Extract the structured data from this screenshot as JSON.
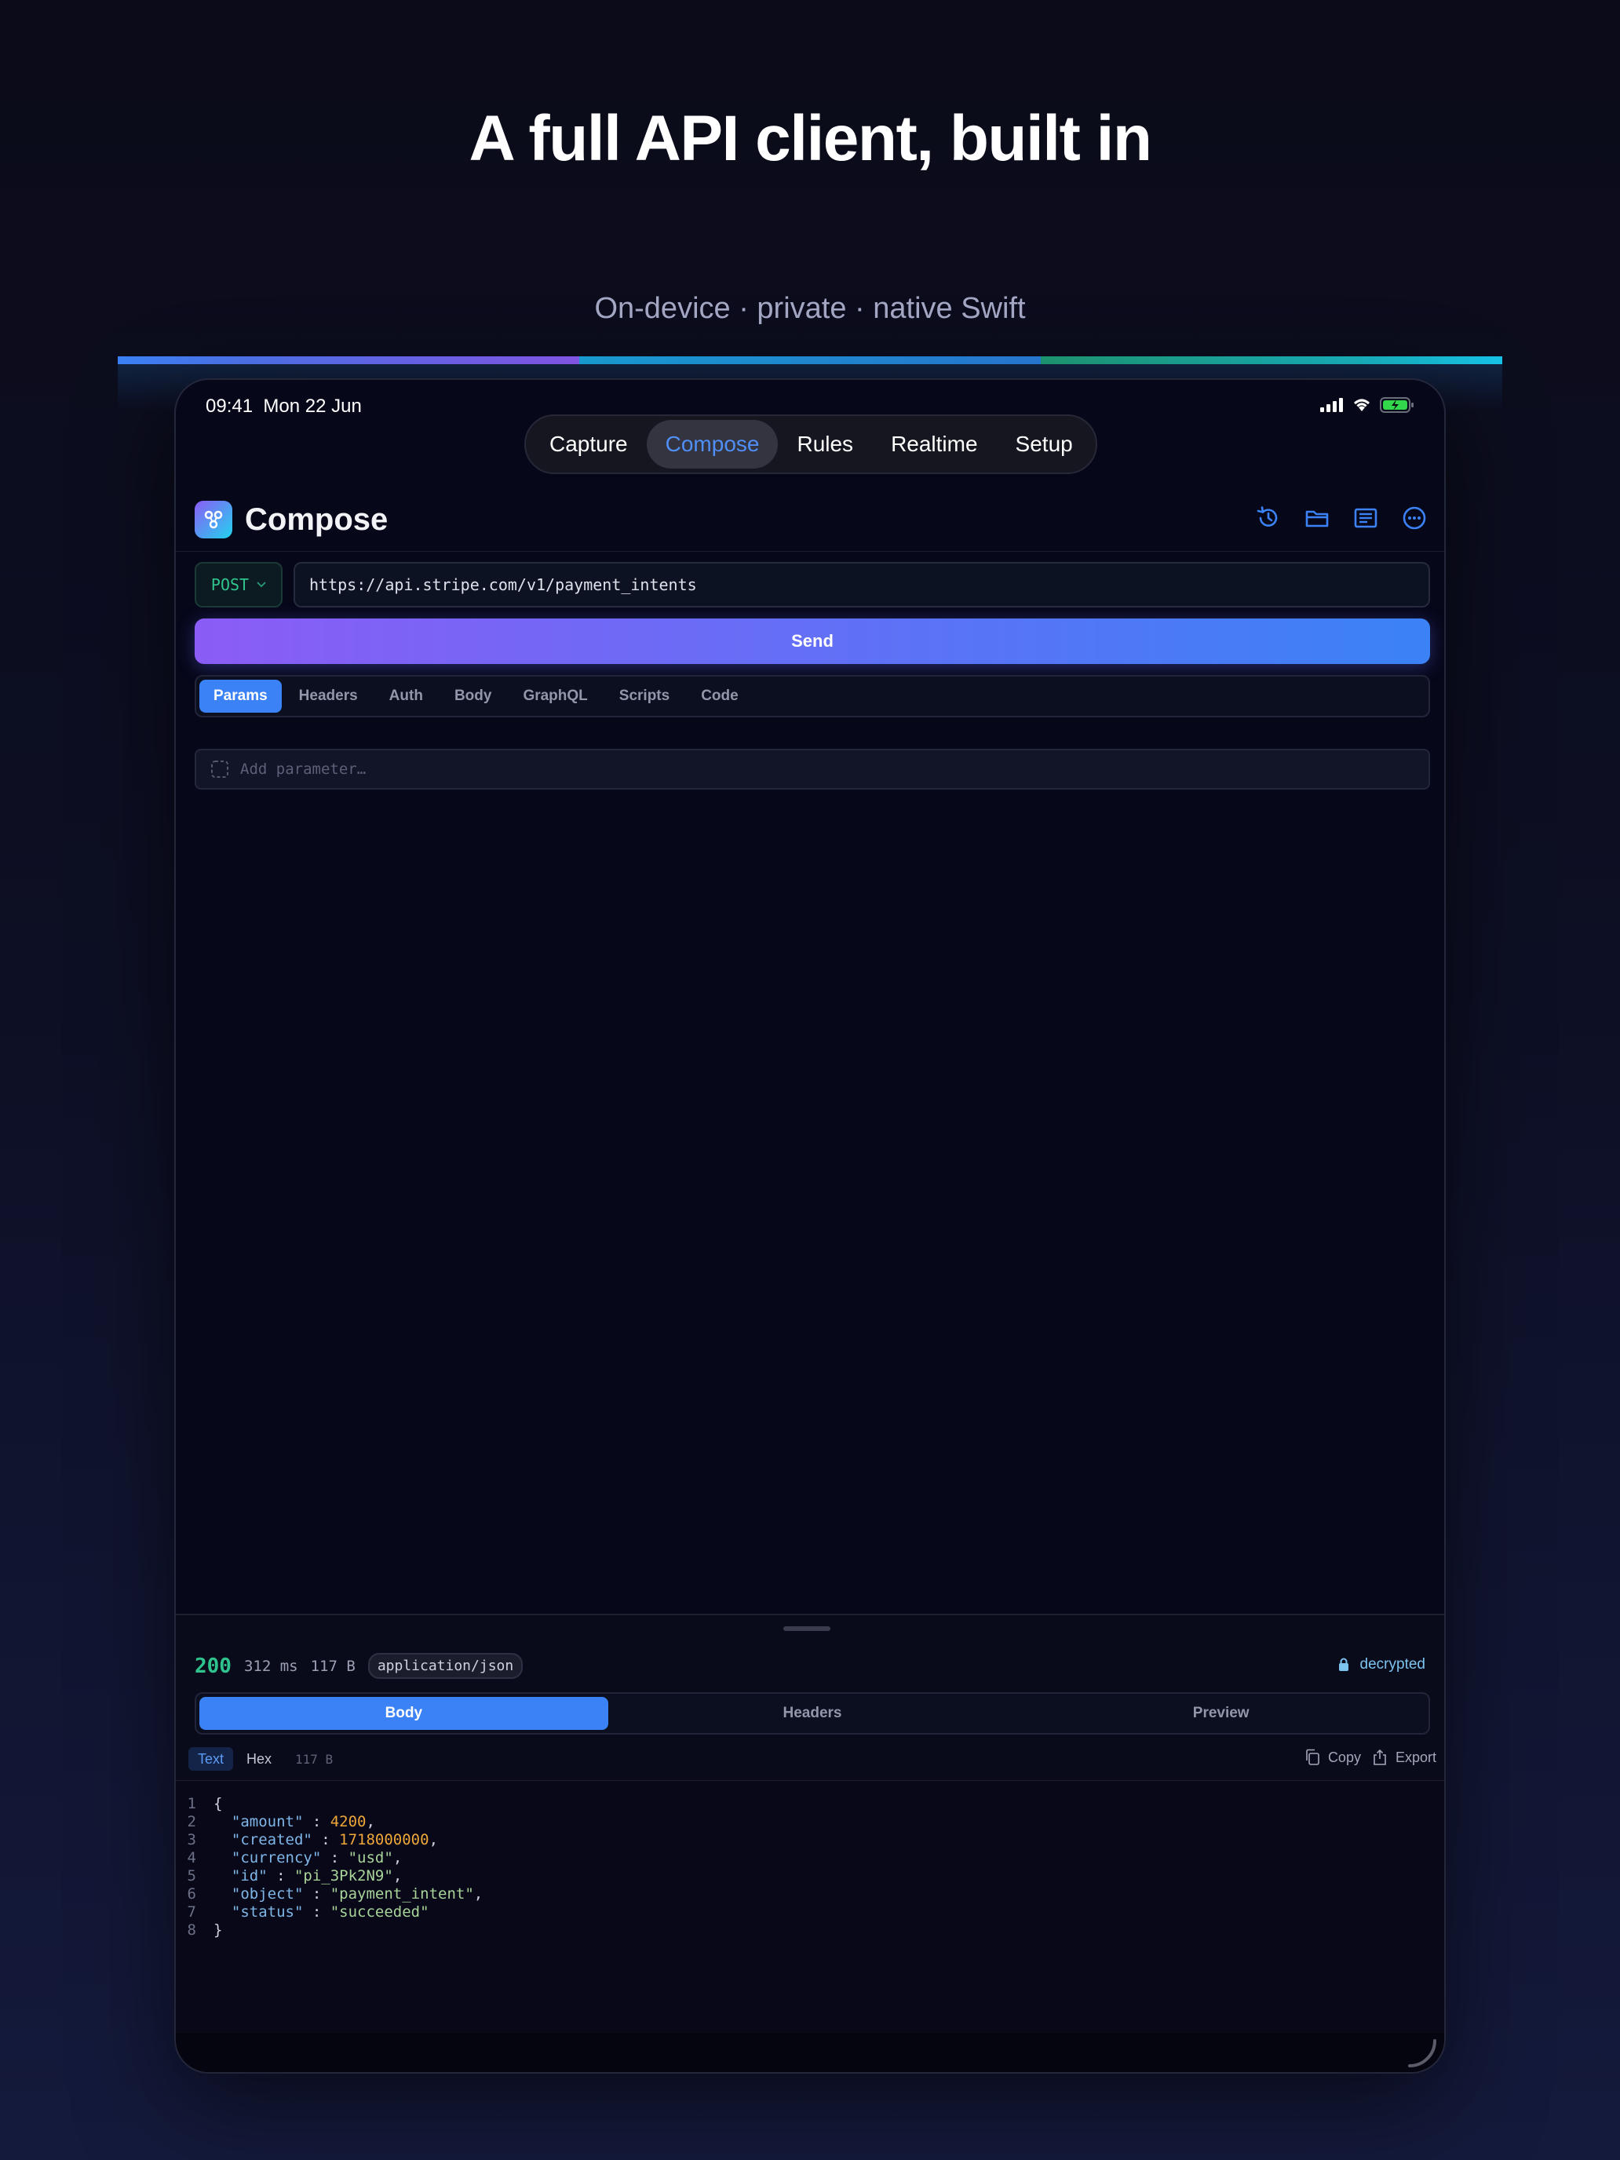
{
  "hero": {
    "title": "A full API client, built in",
    "subtitle": "On-device · private · native Swift"
  },
  "accent_colors": [
    "#3b82f6",
    "#8b5cf6",
    "#1aa7e0",
    "#1f9f77",
    "#17c3e8"
  ],
  "status_bar": {
    "time": "09:41",
    "date": "Mon 22 Jun",
    "icons": [
      "signal-icon",
      "wifi-icon",
      "battery-charging-icon"
    ]
  },
  "mode_tabs": [
    {
      "label": "Capture",
      "active": false
    },
    {
      "label": "Compose",
      "active": true
    },
    {
      "label": "Rules",
      "active": false
    },
    {
      "label": "Realtime",
      "active": false
    },
    {
      "label": "Setup",
      "active": false
    }
  ],
  "header": {
    "title": "Compose",
    "actions": [
      "history-icon",
      "folder-icon",
      "collection-icon",
      "more-icon"
    ]
  },
  "request": {
    "method": "POST",
    "url": "https://api.stripe.com/v1/payment_intents",
    "send_label": "Send",
    "tabs": [
      {
        "label": "Params",
        "active": true
      },
      {
        "label": "Headers",
        "active": false
      },
      {
        "label": "Auth",
        "active": false
      },
      {
        "label": "Body",
        "active": false
      },
      {
        "label": "GraphQL",
        "active": false
      },
      {
        "label": "Scripts",
        "active": false
      },
      {
        "label": "Code",
        "active": false
      }
    ],
    "add_param_placeholder": "Add parameter…"
  },
  "response": {
    "status_code": "200",
    "time": "312 ms",
    "size": "117 B",
    "content_type": "application/json",
    "security_label": "decrypted",
    "tabs": [
      {
        "label": "Body",
        "active": true
      },
      {
        "label": "Headers",
        "active": false
      },
      {
        "label": "Preview",
        "active": false
      }
    ],
    "view_modes": [
      "Text",
      "Hex"
    ],
    "view_size": "117 B",
    "copy_label": "Copy",
    "export_label": "Export",
    "body_lines": [
      {
        "n": "1",
        "key": "",
        "val": "",
        "type": "open",
        "text": "{"
      },
      {
        "n": "2",
        "key": "\"amount\"",
        "val": "4200",
        "type": "num"
      },
      {
        "n": "3",
        "key": "\"created\"",
        "val": "1718000000",
        "type": "num"
      },
      {
        "n": "4",
        "key": "\"currency\"",
        "val": "\"usd\"",
        "type": "str"
      },
      {
        "n": "5",
        "key": "\"id\"",
        "val": "\"pi_3Pk2N9\"",
        "type": "str"
      },
      {
        "n": "6",
        "key": "\"object\"",
        "val": "\"payment_intent\"",
        "type": "str"
      },
      {
        "n": "7",
        "key": "\"status\"",
        "val": "\"succeeded\"",
        "type": "str",
        "last": true
      },
      {
        "n": "8",
        "key": "",
        "val": "",
        "type": "close",
        "text": "}"
      }
    ]
  }
}
